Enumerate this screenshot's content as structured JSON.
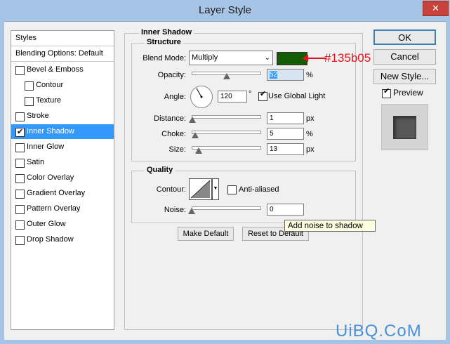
{
  "window": {
    "title": "Layer Style",
    "close_glyph": "✕"
  },
  "styles_list": {
    "header": "Styles",
    "blending": "Blending Options: Default",
    "items": [
      {
        "label": "Bevel & Emboss",
        "checked": false
      },
      {
        "label": "Contour",
        "checked": false
      },
      {
        "label": "Texture",
        "checked": false
      },
      {
        "label": "Stroke",
        "checked": false
      },
      {
        "label": "Inner Shadow",
        "checked": true,
        "selected": true
      },
      {
        "label": "Inner Glow",
        "checked": false
      },
      {
        "label": "Satin",
        "checked": false
      },
      {
        "label": "Color Overlay",
        "checked": false
      },
      {
        "label": "Gradient Overlay",
        "checked": false
      },
      {
        "label": "Pattern Overlay",
        "checked": false
      },
      {
        "label": "Outer Glow",
        "checked": false
      },
      {
        "label": "Drop Shadow",
        "checked": false
      }
    ]
  },
  "inner_shadow": {
    "title": "Inner Shadow",
    "structure_title": "Structure",
    "blend_mode_label": "Blend Mode:",
    "blend_mode_value": "Multiply",
    "shadow_color": "#135b05",
    "annotation_text": "#135b05",
    "annotation_color": "#e0141e",
    "opacity_label": "Opacity:",
    "opacity_value": "52",
    "opacity_fraction": 0.52,
    "percent": "%",
    "px": "px",
    "angle_label": "Angle:",
    "angle_value": "120",
    "degree": "°",
    "global_light_label": "Use Global Light",
    "global_light_checked": true,
    "distance_label": "Distance:",
    "distance_value": "1",
    "distance_fraction": 0.01,
    "choke_label": "Choke:",
    "choke_value": "5",
    "choke_fraction": 0.05,
    "size_label": "Size:",
    "size_value": "13",
    "size_fraction": 0.1
  },
  "quality": {
    "title": "Quality",
    "contour_label": "Contour:",
    "antialiased_label": "Anti-aliased",
    "antialiased_checked": false,
    "noise_label": "Noise:",
    "noise_value": "0",
    "noise_fraction": 0.0,
    "tooltip": "Add noise to shadow"
  },
  "buttons": {
    "make_default": "Make Default",
    "reset_default": "Reset to Default",
    "ok": "OK",
    "cancel": "Cancel",
    "new_style": "New Style...",
    "preview_label": "Preview",
    "preview_checked": true
  },
  "watermark": "UiBQ.CoM"
}
